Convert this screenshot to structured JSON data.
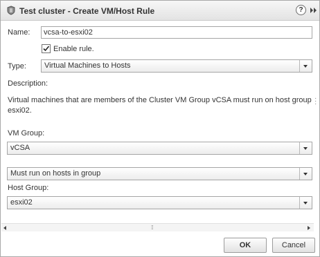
{
  "window": {
    "title": "Test cluster - Create VM/Host Rule",
    "help_icon": "?",
    "icon": "cluster-icon",
    "expand_icon": "double-chevron-right-icon"
  },
  "form": {
    "name_label": "Name:",
    "name_value": "vcsa-to-esxi02",
    "enable_label": "Enable rule.",
    "enable_checked": true,
    "type_label": "Type:",
    "type_value": "Virtual Machines to Hosts",
    "description_label": "Description:",
    "description_text": "Virtual machines that are members of the Cluster VM Group vCSA must run on host group esxi02.",
    "vm_group_label": "VM Group:",
    "vm_group_value": "vCSA",
    "rule_value": "Must run on hosts in group",
    "host_group_label": "Host Group:",
    "host_group_value": "esxi02"
  },
  "buttons": {
    "ok": "OK",
    "cancel": "Cancel"
  }
}
